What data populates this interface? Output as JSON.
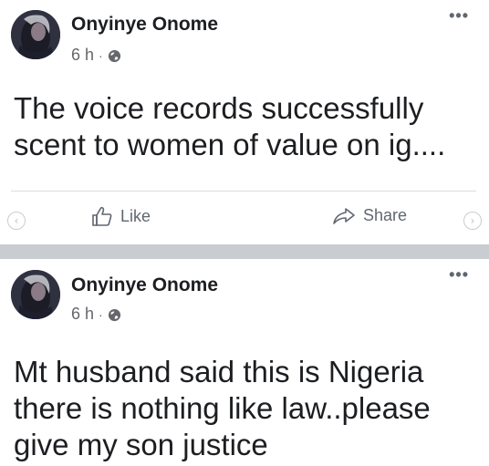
{
  "posts": [
    {
      "author": "Onyinye Onome",
      "time": "6 h",
      "separator": "·",
      "body": "The voice records successfully scent to women of value on ig....",
      "actions": {
        "like_label": "Like",
        "share_label": "Share"
      }
    },
    {
      "author": "Onyinye Onome",
      "time": "6 h",
      "separator": "·",
      "body": "Mt husband said this is Nigeria there is nothing like law..please give my son justice"
    }
  ],
  "icons": {
    "more": "more-options-icon",
    "globe": "globe-icon",
    "like": "thumbs-up-icon",
    "share": "share-arrow-icon"
  },
  "colors": {
    "divider": "#c9ccd1",
    "meta_text": "#65676b",
    "action_text": "#606770"
  }
}
